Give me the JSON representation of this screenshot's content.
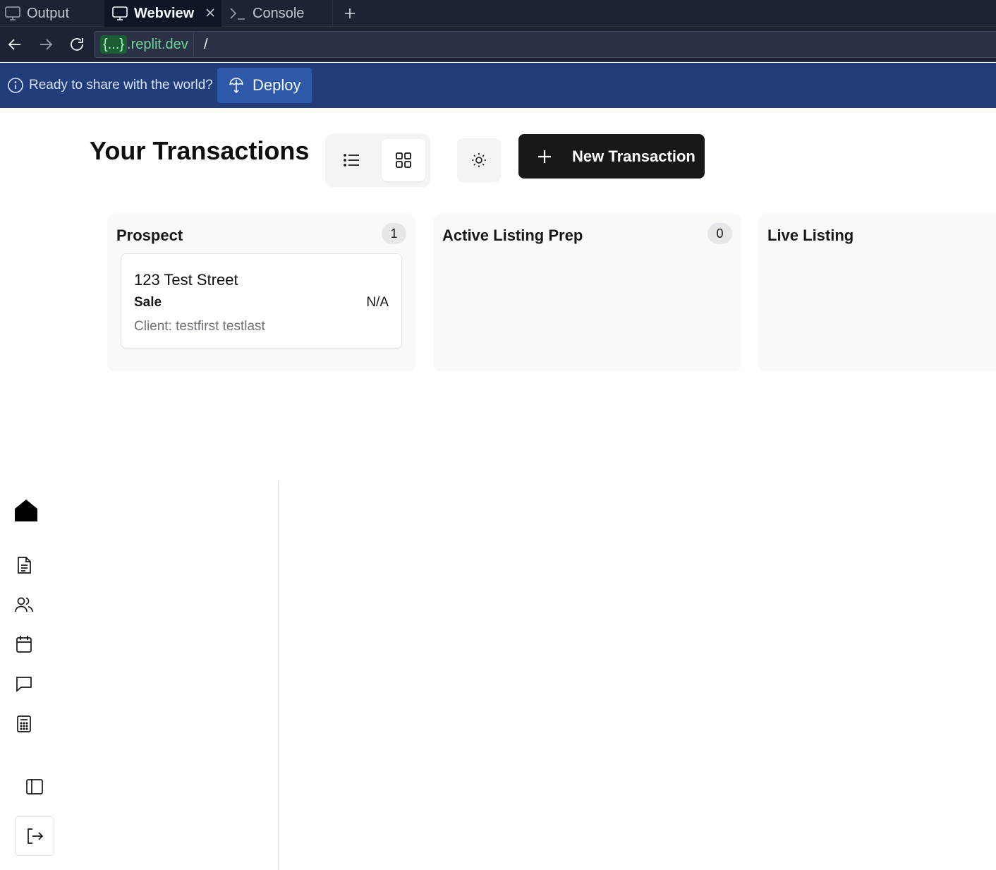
{
  "ide": {
    "tabs": [
      {
        "label": "Output",
        "icon": "monitor-icon"
      },
      {
        "label": "Webview",
        "icon": "monitor-icon",
        "active": true
      },
      {
        "label": "Console",
        "icon": "terminal-icon"
      }
    ],
    "add_tab_icon": "plus-icon",
    "address": {
      "host_badge": "{...}",
      "host": ".replit.dev",
      "path": "/"
    },
    "banner": {
      "text": "Ready to share with the world?",
      "deploy_label": "Deploy"
    }
  },
  "header": {
    "title": "Your Transactions",
    "view_modes": [
      "list",
      "grid"
    ],
    "active_view": "grid",
    "new_button_label": "New Transaction"
  },
  "columns": [
    {
      "title": "Prospect",
      "count": "1",
      "cards": [
        {
          "address": "123 Test Street",
          "type": "Sale",
          "price": "N/A",
          "client": "Client: testfirst testlast"
        }
      ]
    },
    {
      "title": "Active Listing Prep",
      "count": "0",
      "cards": []
    },
    {
      "title": "Live Listing",
      "count": "",
      "cards": []
    }
  ],
  "sidebar": {
    "items": [
      "home-icon",
      "document-icon",
      "users-icon",
      "calendar-icon",
      "message-icon",
      "calculator-icon"
    ],
    "collapse_icon": "sidebar-toggle-icon",
    "logout_icon": "logout-icon"
  },
  "colors": {
    "ide_bg": "#1c2333",
    "banner_bg": "#213d7a",
    "primary_button": "#18181b",
    "column_bg": "#f9f9f8"
  }
}
